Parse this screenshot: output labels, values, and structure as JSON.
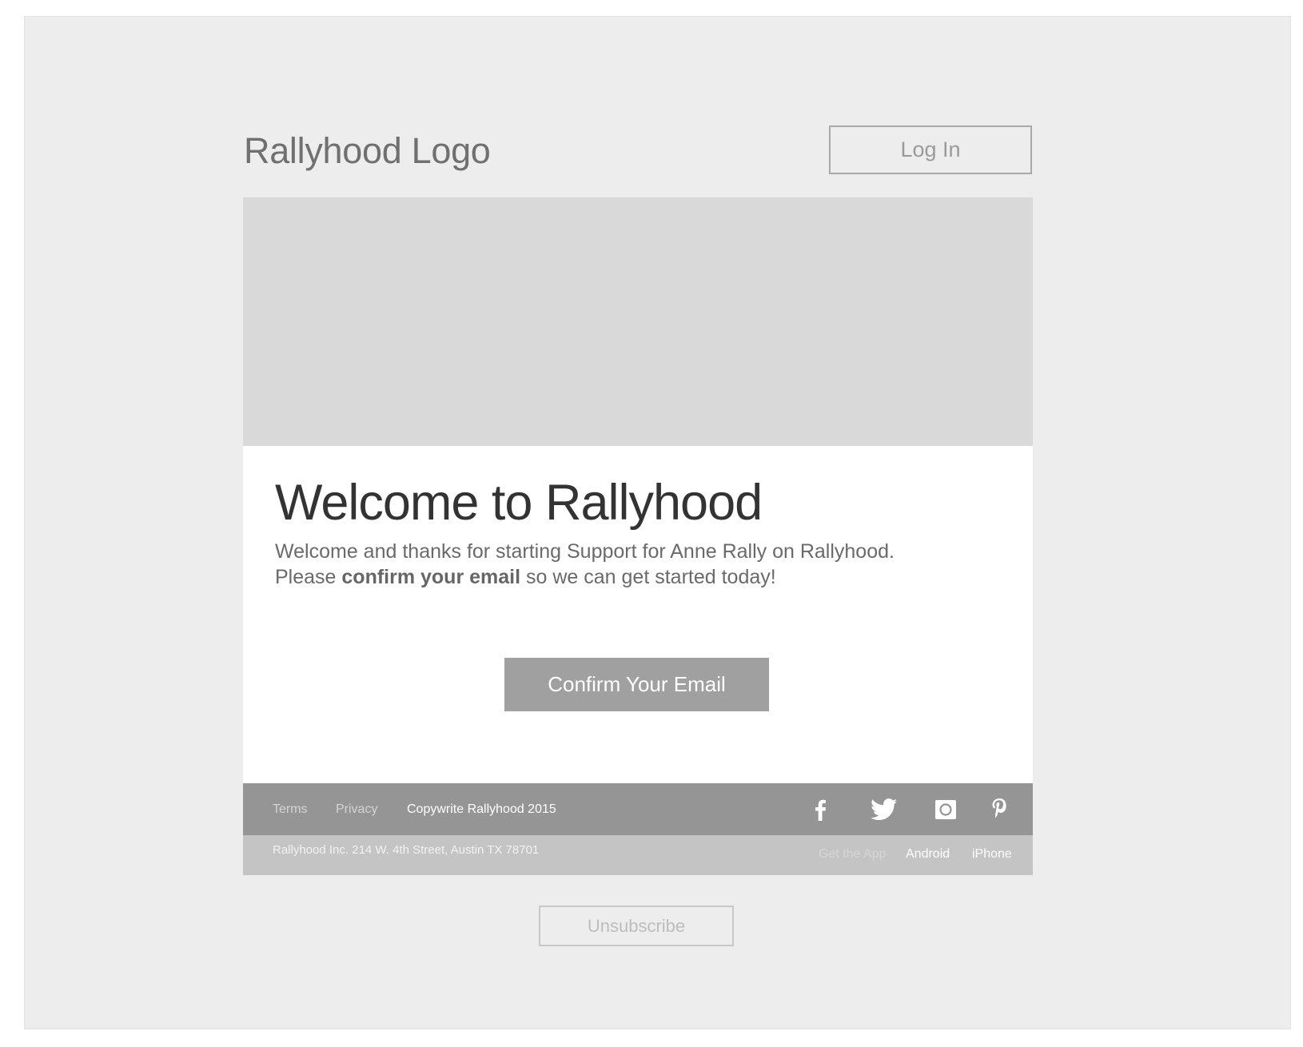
{
  "header": {
    "logo_text": "Rallyhood Logo",
    "login_label": "Log In"
  },
  "hero": {
    "icon": "image-placeholder"
  },
  "main": {
    "headline": "Welcome to Rallyhood",
    "line1": "Welcome and thanks for starting Support for Anne Rally on Rallyhood.",
    "line2_prefix": "Please ",
    "line2_bold": "confirm your email",
    "line2_suffix": " so we can get started today!",
    "confirm_label": "Confirm Your Email"
  },
  "footer": {
    "terms": "Terms",
    "privacy": "Privacy",
    "copyright": "Copywrite Rallyhood 2015",
    "social": [
      {
        "icon": "facebook-icon"
      },
      {
        "icon": "twitter-icon"
      },
      {
        "icon": "instagram-icon"
      },
      {
        "icon": "pinterest-icon"
      }
    ],
    "address": "Rallyhood Inc. 214 W. 4th Street, Austin TX 78701",
    "get_app": "Get the App",
    "android": "Android",
    "iphone": "iPhone"
  },
  "unsubscribe_label": "Unsubscribe",
  "colors": {
    "background": "#ededed",
    "hero": "#d9d9d9",
    "button": "#a0a0a0",
    "footer_top": "#959595",
    "footer_bottom": "#c4c4c4"
  }
}
